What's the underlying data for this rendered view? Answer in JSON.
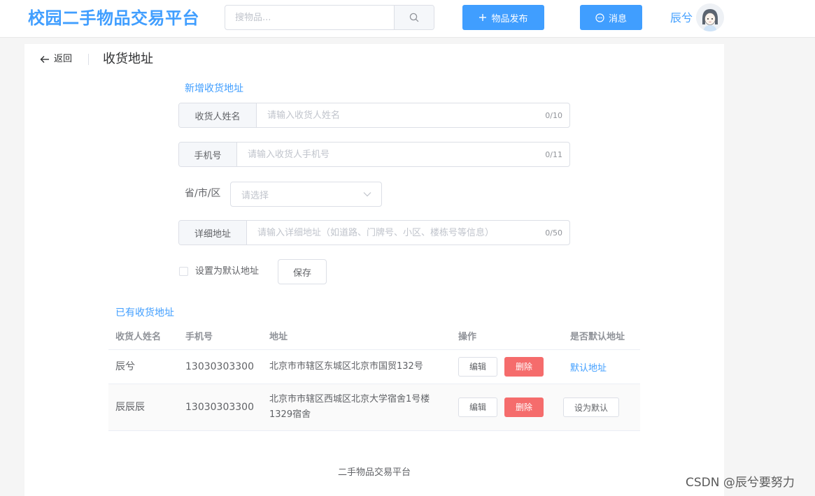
{
  "header": {
    "logo": "校园二手物品交易平台",
    "search_placeholder": "搜物品...",
    "publish_label": "物品发布",
    "message_label": "消息",
    "username": "辰兮"
  },
  "page": {
    "back_label": "返回",
    "title": "收货地址"
  },
  "form": {
    "section_title": "新增收货地址",
    "name": {
      "label": "收货人姓名",
      "placeholder": "请输入收货人姓名",
      "counter": "0/10"
    },
    "phone": {
      "label": "手机号",
      "placeholder": "请输入收货人手机号",
      "counter": "0/11"
    },
    "region": {
      "label": "省/市/区",
      "placeholder": "请选择"
    },
    "detail": {
      "label": "详细地址",
      "placeholder": "请输入详细地址（如道路、门牌号、小区、楼栋号等信息）",
      "counter": "0/50"
    },
    "default_checkbox_label": "设置为默认地址",
    "save_label": "保存"
  },
  "addresses": {
    "section_title": "已有收货地址",
    "columns": [
      "收货人姓名",
      "手机号",
      "地址",
      "操作",
      "是否默认地址"
    ],
    "edit_label": "编辑",
    "delete_label": "删除",
    "rows": [
      {
        "name": "辰兮",
        "phone": "13030303300",
        "address": "北京市市辖区东城区北京市国贸132号",
        "default_text": "默认地址"
      },
      {
        "name": "辰辰辰",
        "phone": "13030303300",
        "address": "北京市市辖区西城区北京大学宿舍1号楼1329宿舍",
        "default_text": "设为默认"
      }
    ]
  },
  "footer": "二手物品交易平台",
  "watermark": "CSDN @辰兮要努力",
  "colors": {
    "primary": "#409eff",
    "danger": "#f56c6c"
  }
}
